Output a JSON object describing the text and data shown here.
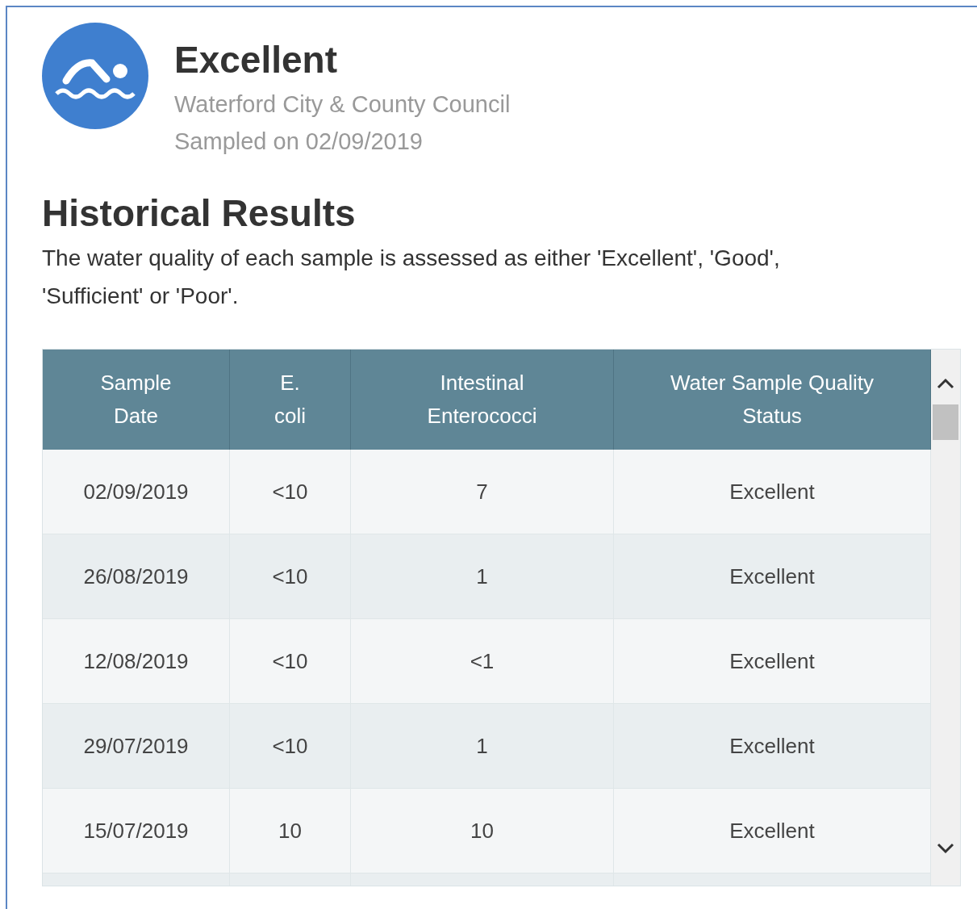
{
  "result": {
    "title": "Excellent",
    "authority": "Waterford City & County Council",
    "sampled": "Sampled on 02/09/2019"
  },
  "historical": {
    "heading": "Historical Results",
    "description": "The water quality of each sample is assessed as either 'Excellent', 'Good', 'Sufficient' or 'Poor'."
  },
  "table": {
    "columns": [
      "Sample Date",
      "E. coli",
      "Intestinal Enterococci",
      "Water Sample Quality Status"
    ],
    "rows": [
      {
        "date": "02/09/2019",
        "e_coli": "<10",
        "intestinal_enterococci": "7",
        "status": "Excellent"
      },
      {
        "date": "26/08/2019",
        "e_coli": "<10",
        "intestinal_enterococci": "1",
        "status": "Excellent"
      },
      {
        "date": "12/08/2019",
        "e_coli": "<10",
        "intestinal_enterococci": "<1",
        "status": "Excellent"
      },
      {
        "date": "29/07/2019",
        "e_coli": "<10",
        "intestinal_enterococci": "1",
        "status": "Excellent"
      },
      {
        "date": "15/07/2019",
        "e_coli": "10",
        "intestinal_enterococci": "10",
        "status": "Excellent"
      }
    ]
  }
}
